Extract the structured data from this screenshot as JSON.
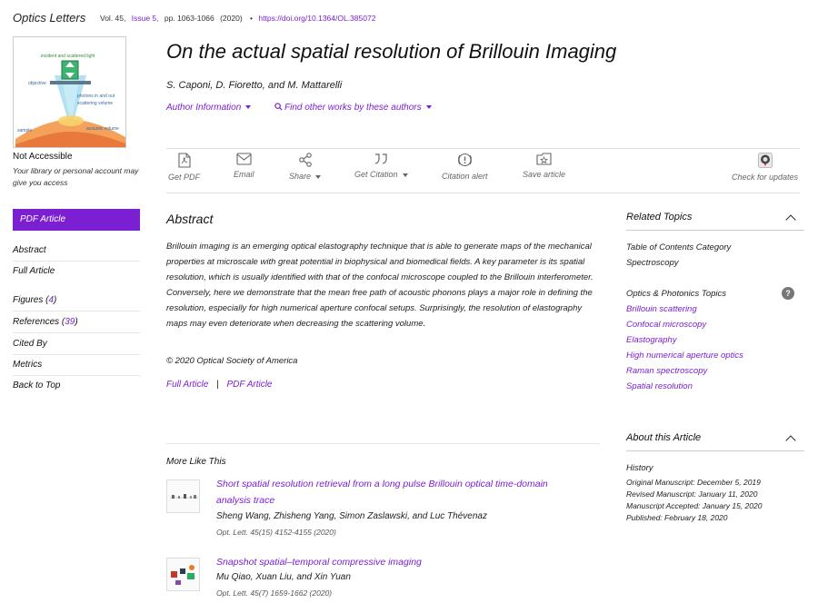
{
  "header": {
    "journal": "Optics Letters",
    "volume": "Vol. 45,",
    "issue": "Issue 5,",
    "pages": "pp. 1063-1066",
    "year": "(2020)",
    "bullet": "•",
    "doi": "https://doi.org/10.1364/OL.385072"
  },
  "sidebar": {
    "access_title": "Not Accessible",
    "access_sub": "Your library or personal account may give you access",
    "pdf_button": "PDF Article",
    "nav": [
      {
        "label": "Abstract"
      },
      {
        "label": "Full Article"
      },
      {
        "label": "Figures",
        "count": "4"
      },
      {
        "label": "References",
        "count": "39"
      },
      {
        "label": "Cited By"
      },
      {
        "label": "Metrics"
      },
      {
        "label": "Back to Top"
      }
    ]
  },
  "cover": {
    "labels": {
      "top": "incident and scattered light",
      "objective": "objective",
      "photons": "photons in and out",
      "scattering": "scattering volume",
      "sample": "sample",
      "acoustic": "acoustic volume"
    }
  },
  "article": {
    "title": "On the actual spatial resolution of Brillouin Imaging",
    "authors": "S. Caponi, D. Fioretto, and M. Mattarelli",
    "author_info": "Author Information",
    "find_works": "Find other works by these authors"
  },
  "toolbar": [
    {
      "label": "Get PDF",
      "icon": "pdf-icon"
    },
    {
      "label": "Email",
      "icon": "email-icon"
    },
    {
      "label": "Share",
      "icon": "share-icon"
    },
    {
      "label": "Get Citation",
      "icon": "quote-icon"
    },
    {
      "label": "Citation alert",
      "icon": "alert-icon"
    },
    {
      "label": "Save article",
      "icon": "save-folder-icon"
    },
    {
      "label": "Check for updates",
      "icon": "crossmark-icon"
    }
  ],
  "abstract": {
    "heading": "Abstract",
    "text": "Brillouin imaging is an emerging optical elastography technique that is able to generate maps of the mechanical properties at microscale with great potential in biophysical and biomedical fields. A key parameter is its spatial resolution, which is usually identified with that of the confocal microscope coupled to the Brillouin interferometer. Conversely, here we demonstrate that the mean free path of acoustic phonons plays a major role in defining the resolution, especially for high numerical aperture confocal setups. Surprisingly, the resolution of elastography maps may even deteriorate when decreasing the scattering volume.",
    "copyright": "© 2020 Optical Society of America",
    "link_full": "Full Article",
    "separator": "|",
    "link_pdf": "PDF Article"
  },
  "more_like_this": {
    "heading": "More Like This",
    "items": [
      {
        "title": "Short spatial resolution retrieval from a long pulse Brillouin optical time-domain analysis trace",
        "authors": "Sheng Wang, Zhisheng Yang, Simon Zaslawski, and Luc Thévenaz",
        "citation": "Opt. Lett. 45(15) 4152-4155 (2020)"
      },
      {
        "title": "Snapshot spatial–temporal compressive imaging",
        "authors": "Mu Qiao, Xuan Liu, and Xin Yuan",
        "citation": "Opt. Lett. 45(7) 1659-1662 (2020)"
      }
    ]
  },
  "related": {
    "heading": "Related Topics",
    "toc_label": "Table of Contents Category",
    "toc_value": "Spectroscopy",
    "topics_label": "Optics & Photonics Topics",
    "help": "?",
    "topics": [
      "Brillouin scattering",
      "Confocal microscopy",
      "Elastography",
      "High numerical aperture optics",
      "Raman spectroscopy",
      "Spatial resolution"
    ]
  },
  "about": {
    "heading": "About this Article",
    "history_label": "History",
    "history": [
      "Original Manuscript: December 5, 2019",
      "Revised Manuscript: January 11, 2020",
      "Manuscript Accepted: January 15, 2020",
      "Published: February 18, 2020"
    ]
  },
  "colors": {
    "accent": "#7a1fd1",
    "text": "#222222",
    "divider": "#dddddd"
  }
}
